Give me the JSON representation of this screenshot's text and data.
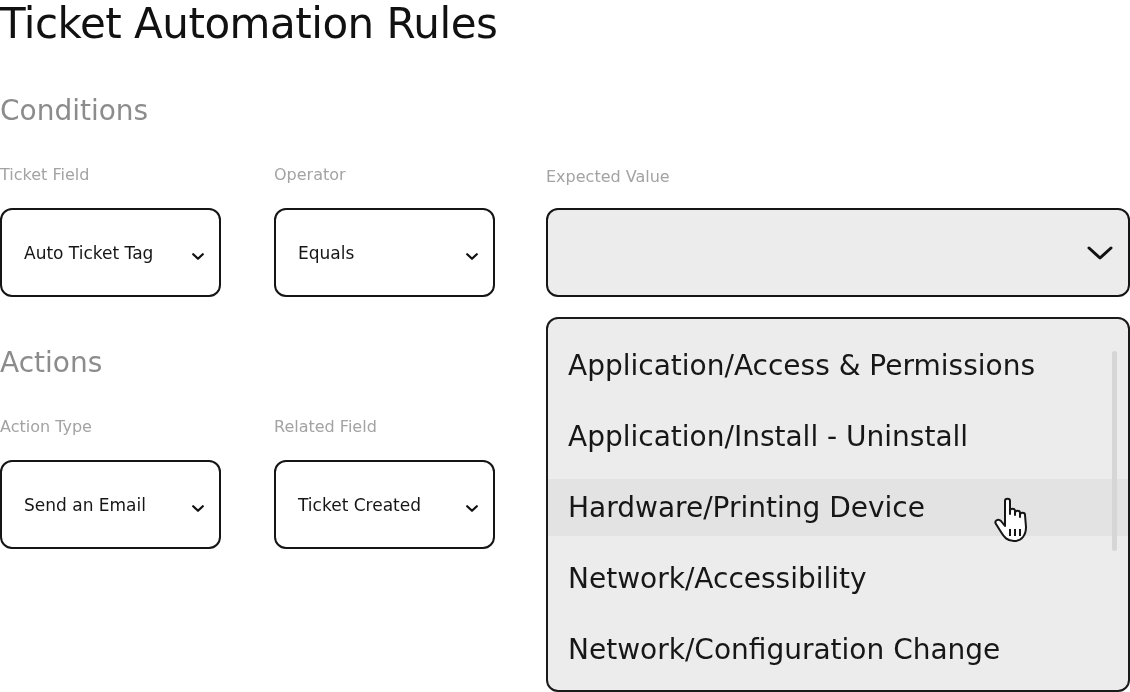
{
  "title": "Ticket Automation Rules",
  "conditions": {
    "heading": "Conditions",
    "fields": [
      {
        "label": "Ticket Field",
        "value": "Auto Ticket Tag"
      },
      {
        "label": "Operator",
        "value": "Equals"
      },
      {
        "label": "Expected Value",
        "expanded": true,
        "options": [
          {
            "label": "Application/Access & Permissions",
            "highlighted": false
          },
          {
            "label": "Application/Install - Uninstall",
            "highlighted": false
          },
          {
            "label": "Hardware/Printing Device",
            "highlighted": true
          },
          {
            "label": "Network/Accessibility",
            "highlighted": false
          },
          {
            "label": "Network/Configuration Change",
            "highlighted": false
          }
        ]
      }
    ]
  },
  "actions": {
    "heading": "Actions",
    "fields": [
      {
        "label": "Action Type",
        "value": "Send an Email"
      },
      {
        "label": "Related Field",
        "value": "Ticket Created"
      }
    ]
  }
}
